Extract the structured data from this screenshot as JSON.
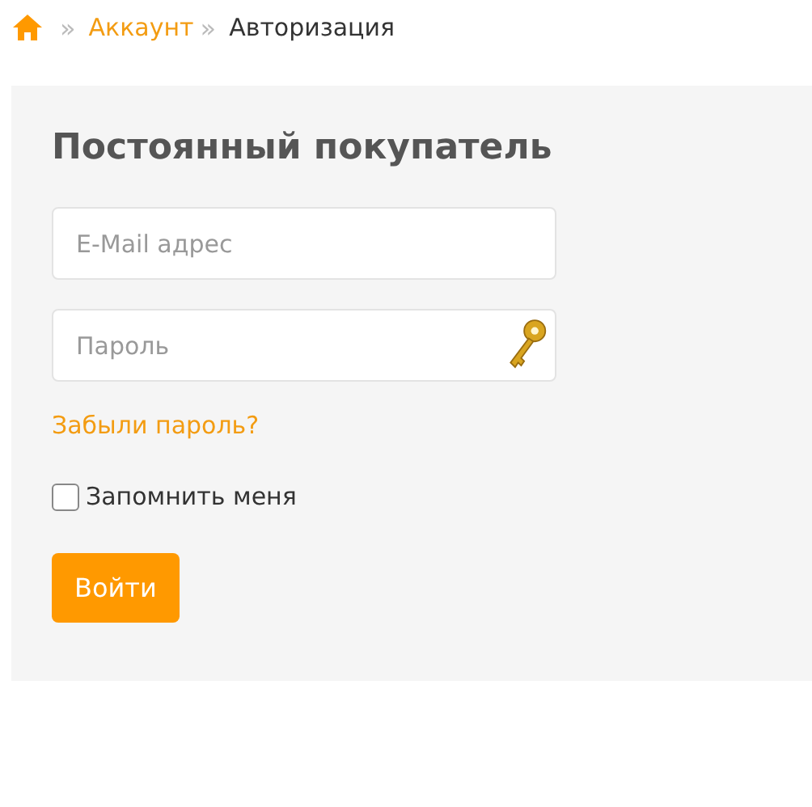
{
  "breadcrumb": [
    {
      "kind": "home"
    },
    {
      "kind": "link",
      "separator": "»",
      "label": "Аккаунт"
    },
    {
      "kind": "current",
      "separator": "»",
      "label": "Авторизация"
    }
  ],
  "login": {
    "title": "Постоянный покупатель",
    "email": {
      "placeholder": "E-Mail адрес"
    },
    "password": {
      "placeholder": "Пароль"
    },
    "forgot_link": "Забыли пароль?",
    "remember": {
      "label": "Запомнить меня",
      "checked": false
    },
    "submit": "Войти"
  }
}
